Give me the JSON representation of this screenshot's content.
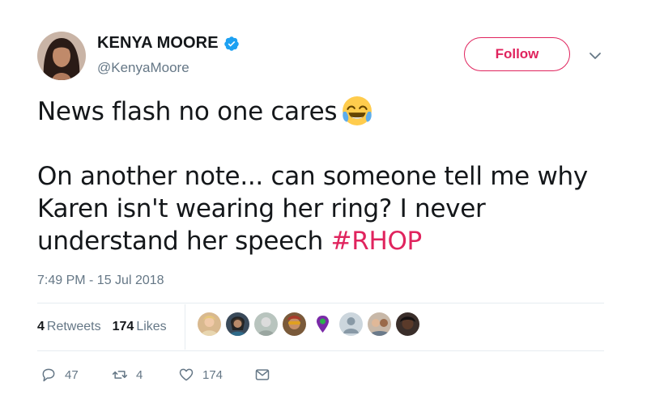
{
  "author": {
    "name": "KENYA MOORE",
    "handle": "@KenyaMoore",
    "verified": true
  },
  "follow_button": {
    "label": "Follow",
    "color": "#e0245e"
  },
  "tweet": {
    "line1": "News flash no one cares",
    "line2": "On another note... can someone tell me why",
    "line3": "Karen isn't wearing her ring? I never",
    "line4_text": "understand her speech",
    "hashtag": "#RHOP",
    "emoji": "face-with-tears-of-joy"
  },
  "timestamp": "7:49 PM - 15 Jul 2018",
  "stats": {
    "retweets_count": "4",
    "retweets_label": "Retweets",
    "likes_count": "174",
    "likes_label": "Likes"
  },
  "actions": {
    "replies": "47",
    "retweets": "4",
    "likes": "174"
  },
  "colors": {
    "accent": "#e0245e",
    "muted": "#657786",
    "verified": "#1da1f2",
    "text": "#14171a"
  },
  "icons": [
    "verified-badge-icon",
    "chevron-down-icon",
    "reply-icon",
    "retweet-icon",
    "heart-icon",
    "message-icon"
  ]
}
